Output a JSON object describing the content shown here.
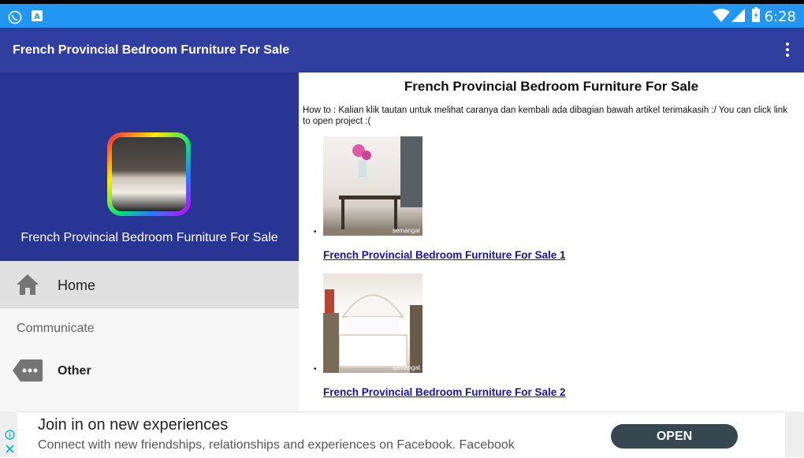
{
  "status_bar": {
    "time": "6:28",
    "icons": [
      "whatsapp-icon",
      "a-notification-icon",
      "wifi-icon",
      "signal-icon",
      "battery-icon"
    ]
  },
  "app_bar": {
    "title": "French Provincial Bedroom Furniture For Sale",
    "menu_icon": "overflow-menu-icon"
  },
  "drawer": {
    "app_name": "French Provincial Bedroom Furniture For Sale",
    "items": [
      {
        "label": "Home",
        "icon": "home-icon",
        "selected": true
      }
    ],
    "section_header": "Communicate",
    "section_items": [
      {
        "label": "Other",
        "icon": "more-tag-icon"
      }
    ]
  },
  "content": {
    "title": "French Provincial Bedroom Furniture For Sale",
    "howto": "How to : Kalian klik tautan untuk melihat caranya dan kembali ada dibagian bawah artikel terimakasih :/ You can click link to open project :(",
    "items": [
      {
        "link": "French Provincial Bedroom Furniture For Sale 1",
        "watermark": "semangat"
      },
      {
        "link": "French Provincial Bedroom Furniture For Sale 2",
        "watermark": "semangat"
      }
    ]
  },
  "ad": {
    "headline": "Join in on new experiences",
    "body": "Connect with new friendships, relationships and experiences on Facebook. Facebook",
    "cta": "OPEN"
  },
  "colors": {
    "status_bar": "#2196f3",
    "app_bar": "#303f9f",
    "drawer_header": "#283593",
    "link": "#1a0dab",
    "ad_button": "#37474f"
  }
}
